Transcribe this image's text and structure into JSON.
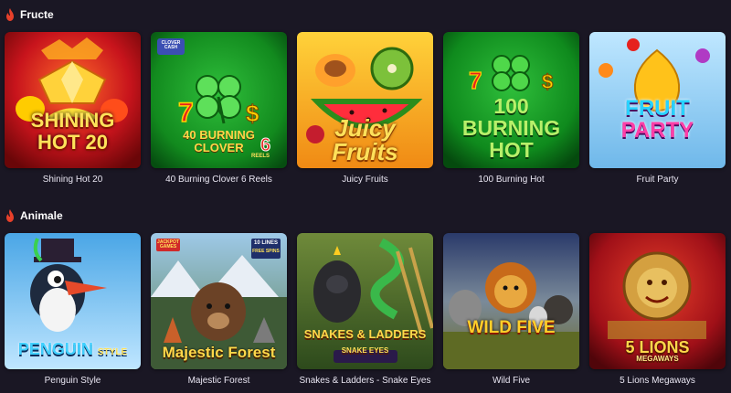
{
  "sections": [
    {
      "title": "Fructe",
      "games": [
        {
          "name": "Shining Hot 20",
          "logo": [
            "SHINING",
            "HOT 20"
          ]
        },
        {
          "name": "40 Burning Clover 6 Reels",
          "logo": [
            "40 BURNING",
            "CLOVER"
          ],
          "badge": "CLOVER CASH",
          "reels": "REELS"
        },
        {
          "name": "Juicy Fruits",
          "logo": [
            "Juicy",
            "Fruits"
          ]
        },
        {
          "name": "100 Burning Hot",
          "logo": [
            "100",
            "BURNING",
            "HOT"
          ]
        },
        {
          "name": "Fruit Party",
          "logo": [
            "FRUIT",
            "PARTY"
          ]
        }
      ]
    },
    {
      "title": "Animale",
      "games": [
        {
          "name": "Penguin Style",
          "logo": [
            "PENGUIN",
            "STYLE"
          ]
        },
        {
          "name": "Majestic Forest",
          "logo": [
            "Majestic Forest"
          ],
          "badge": "JACKPOT GAMES",
          "lines": "10 LINES",
          "spins": "FREE SPINS"
        },
        {
          "name": "Snakes & Ladders - Snake Eyes",
          "logo": [
            "SNAKES & LADDERS",
            "SNAKE EYES"
          ]
        },
        {
          "name": "Wild Five",
          "logo": [
            "WILD FIVE"
          ]
        },
        {
          "name": "5 Lions Megaways",
          "logo": [
            "5 LIONS",
            "MEGAWAYS"
          ]
        }
      ]
    }
  ],
  "icons": {
    "section": "flame-icon"
  },
  "colors": {
    "background": "#1a1724",
    "flame": "#e8402a",
    "text": "#e9e6f2"
  }
}
